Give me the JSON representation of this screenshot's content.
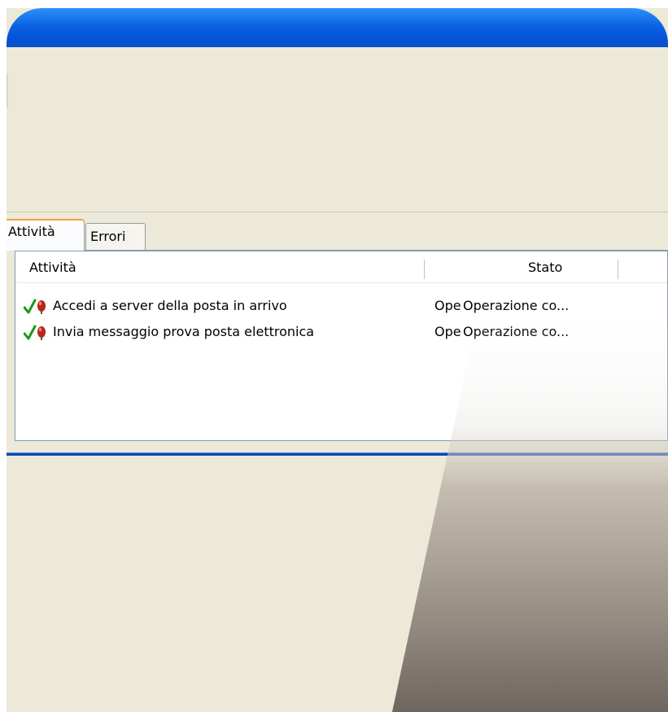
{
  "tabs": {
    "active": "Attività",
    "inactive": "Errori"
  },
  "columns": {
    "activity": "Attività",
    "status": "Stato"
  },
  "rows": [
    {
      "icon": "check-and-warning-icon",
      "text": "Accedi a server della posta in arrivo",
      "status_clipped": "Ope",
      "status": "Operazione co..."
    },
    {
      "icon": "check-and-warning-icon",
      "text": "Invia messaggio prova posta elettronica",
      "status_clipped": "Ope",
      "status": "Operazione co..."
    }
  ],
  "colors": {
    "title_bar": "#0a64e2",
    "window_bg": "#ece9d8",
    "active_tab_accent": "#f0a23c",
    "check": "#1a9a1a",
    "separator_blue": "#0b48b8"
  }
}
